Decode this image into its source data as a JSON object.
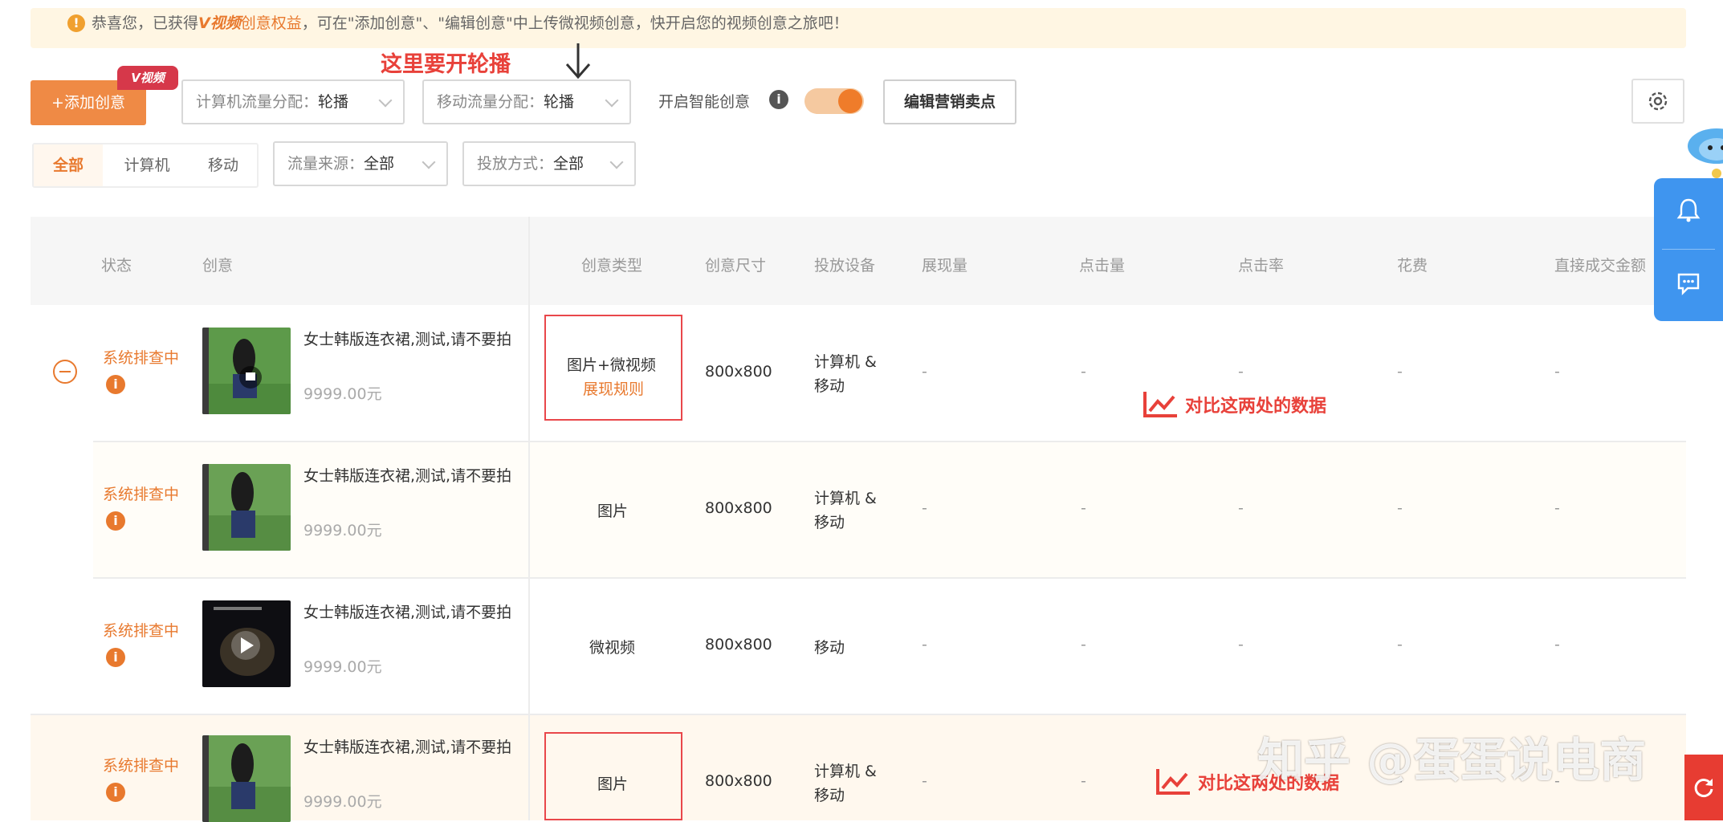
{
  "notice": {
    "prefix": "恭喜您，已获得",
    "brand": "V视频",
    "highlight": "创意权益",
    "suffix": "，可在\"添加创意\"、\"编辑创意\"中上传微视频创意，快开启您的视频创意之旅吧！"
  },
  "toolbar": {
    "add_label": "+添加创意",
    "v_badge": "V视频",
    "pc_traffic_label": "计算机流量分配：",
    "pc_traffic_value": "轮播",
    "mobile_traffic_label": "移动流量分配：",
    "mobile_traffic_value": "轮播",
    "annotation": "这里要开轮播",
    "smart_label": "开启智能创意",
    "edit_selling_points": "编辑营销卖点"
  },
  "device_tabs": [
    "全部",
    "计算机",
    "移动"
  ],
  "filters": {
    "source_label": "流量来源：",
    "source_value": "全部",
    "method_label": "投放方式：",
    "method_value": "全部"
  },
  "table": {
    "columns": [
      "状态",
      "创意",
      "创意类型",
      "创意尺寸",
      "投放设备",
      "展现量",
      "点击量",
      "点击率",
      "花费",
      "直接成交金额"
    ],
    "rows": [
      {
        "status": "系统排查中",
        "title": "女士韩版连衣裙,测试,请不要拍",
        "price": "9999.00元",
        "type": "图片+微视频",
        "type_link": "展现规则",
        "size": "800x800",
        "device": "计算机 & 移动",
        "impressions": "-",
        "clicks": "-",
        "ctr": "-",
        "cost": "-",
        "deal": "-"
      },
      {
        "status": "系统排查中",
        "title": "女士韩版连衣裙,测试,请不要拍",
        "price": "9999.00元",
        "type": "图片",
        "size": "800x800",
        "device": "计算机 & 移动",
        "impressions": "-",
        "clicks": "-",
        "ctr": "-",
        "cost": "-",
        "deal": "-"
      },
      {
        "status": "系统排查中",
        "title": "女士韩版连衣裙,测试,请不要拍",
        "price": "9999.00元",
        "type": "微视频",
        "size": "800x800",
        "device": "移动",
        "impressions": "-",
        "clicks": "-",
        "ctr": "-",
        "cost": "-",
        "deal": "-"
      },
      {
        "status": "系统排查中",
        "title": "女士韩版连衣裙,测试,请不要拍",
        "price": "9999.00元",
        "type": "图片",
        "size": "800x800",
        "device": "计算机 & 移动",
        "impressions": "-",
        "clicks": "-",
        "ctr": "-",
        "cost": "-",
        "deal": "-"
      }
    ]
  },
  "annotations": {
    "compare_1": "对比这两处的数据",
    "compare_2": "对比这两处的数据"
  },
  "watermark": "知乎 @蛋蛋说电商",
  "colors": {
    "accent": "#ef8a45",
    "annotation_red": "#e8413a",
    "float_blue": "#3f95ef"
  }
}
